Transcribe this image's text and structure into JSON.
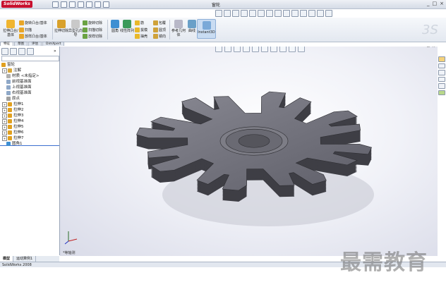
{
  "app": {
    "logo_text": "SolidWorks",
    "doc_title": "窗轮",
    "win_buttons": [
      "_",
      "□",
      "×"
    ]
  },
  "ribbon": {
    "extrude_boss": "拉伸凸台/基体",
    "revolve_boss": "旋转凸台/基体",
    "sweep": "扫描",
    "loft_boss": "放样凸台/基体",
    "extrude_cut": "拉伸切除",
    "hole_wizard": "异型孔向导",
    "revolve_cut": "旋转切除",
    "sweep_cut": "扫描切除",
    "loft_cut": "放样切除",
    "fillet": "圆角",
    "linear_pattern": "线性阵列",
    "rib": "筋",
    "draft": "拔模",
    "shell": "抽壳",
    "wrap": "包覆",
    "dome": "圆顶",
    "mirror": "镜向",
    "ref_geometry": "参考几何体",
    "curves": "曲线",
    "instant3d": "Instant3D"
  },
  "tabs": [
    "特征",
    "草图",
    "评估",
    "DimXpert"
  ],
  "tree": {
    "root": "窗轮",
    "items": [
      {
        "label": "注解",
        "exp": "+",
        "icon": "annotations-icon"
      },
      {
        "label": "材质 <未指定>",
        "exp": "",
        "icon": "material-icon"
      },
      {
        "label": "前视基准面",
        "exp": "",
        "icon": "plane-icon"
      },
      {
        "label": "上视基准面",
        "exp": "",
        "icon": "plane-icon"
      },
      {
        "label": "右视基准面",
        "exp": "",
        "icon": "plane-icon"
      },
      {
        "label": "原点",
        "exp": "",
        "icon": "origin-icon"
      },
      {
        "label": "拉伸1",
        "exp": "+",
        "icon": "extrude-icon"
      },
      {
        "label": "拉伸2",
        "exp": "+",
        "icon": "extrude-icon"
      },
      {
        "label": "拉伸3",
        "exp": "+",
        "icon": "extrude-icon"
      },
      {
        "label": "拉伸4",
        "exp": "+",
        "icon": "extrude-icon"
      },
      {
        "label": "拉伸5",
        "exp": "+",
        "icon": "extrude-icon"
      },
      {
        "label": "拉伸6",
        "exp": "+",
        "icon": "extrude-icon"
      },
      {
        "label": "拉伸7",
        "exp": "+",
        "icon": "extrude-icon"
      },
      {
        "label": "圆角1",
        "exp": "",
        "icon": "fillet-icon"
      }
    ]
  },
  "bottom_tabs": [
    "模型",
    "运动算例1"
  ],
  "status": {
    "app_name": "SolidWorks 2008",
    "view_label": "*等轴测"
  },
  "watermark": "最需教育",
  "colors": {
    "logo_red": "#c8102e",
    "part_gray": "#6e6e76",
    "ribbon_bg": "#e3e8f0"
  }
}
